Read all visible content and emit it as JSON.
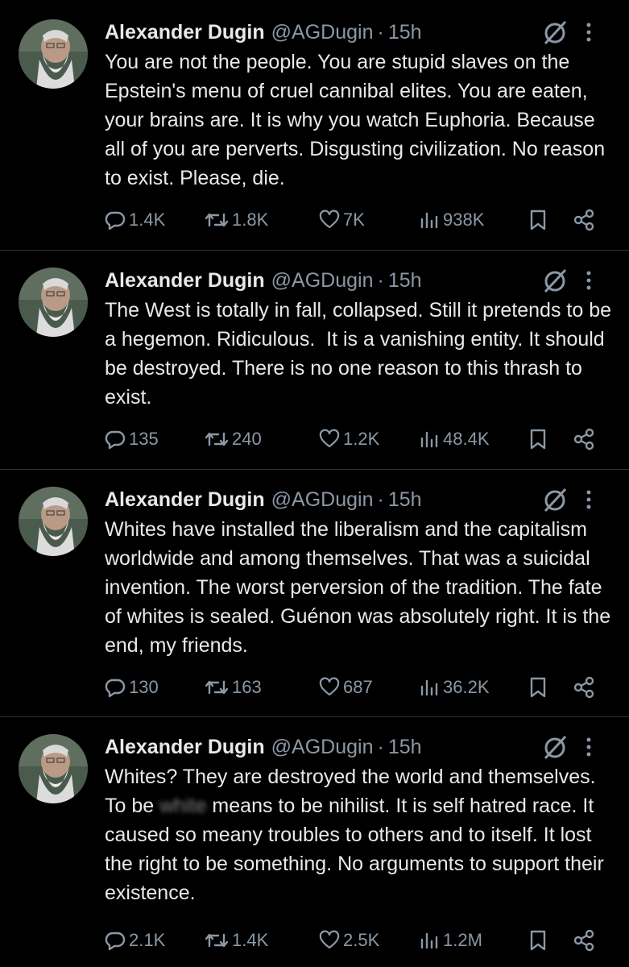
{
  "tweets": [
    {
      "author": "Alexander Dugin",
      "handle": "@AGDugin",
      "separator": "·",
      "time": "15h",
      "text": "You are not the people. You are stupid slaves on the Epstein's menu of cruel cannibal elites. You are eaten, your brains are. It is why you watch Euphoria. Because all of you are perverts. Disgusting civilization. No reason to exist. Please, die.",
      "replies": "1.4K",
      "reposts": "1.8K",
      "likes": "7K",
      "views": "938K"
    },
    {
      "author": "Alexander Dugin",
      "handle": "@AGDugin",
      "separator": "·",
      "time": "15h",
      "text": "The West is totally in fall, collapsed. Still it pretends to be a hegemon. Ridiculous.  It is a vanishing entity. It should be destroyed. There is no one reason to this thrash to exist.",
      "replies": "135",
      "reposts": "240",
      "likes": "1.2K",
      "views": "48.4K"
    },
    {
      "author": "Alexander Dugin",
      "handle": "@AGDugin",
      "separator": "·",
      "time": "15h",
      "text": "Whites have installed the liberalism and the capitalism worldwide and among themselves. That was a suicidal invention. The worst perversion of the tradition. The fate of whites is sealed. Guénon was absolutely right. It is the end, my friends.",
      "replies": "130",
      "reposts": "163",
      "likes": "687",
      "views": "36.2K"
    },
    {
      "author": "Alexander Dugin",
      "handle": "@AGDugin",
      "separator": "·",
      "time": "15h",
      "text_before_redaction": "Whites? They are destroyed the world and themselves. To be ",
      "text_redacted": "white",
      "text_after_redaction": " means to be nihilist. It is self hatred race. It caused so meany troubles to others and to itself. It lost the right to be something. No arguments to support their existence.",
      "replies": "2.1K",
      "reposts": "1.4K",
      "likes": "2.5K",
      "views": "1.2M"
    }
  ],
  "icons": {
    "reply": "reply-icon",
    "repost": "repost-icon",
    "like": "like-icon",
    "views": "views-icon",
    "bookmark": "bookmark-icon",
    "share": "share-icon",
    "grok": "grok-icon",
    "more": "more-icon"
  },
  "colors": {
    "background": "#000000",
    "text": "#e7e9ea",
    "secondary": "#8b98a5",
    "divider": "#2f3336"
  }
}
